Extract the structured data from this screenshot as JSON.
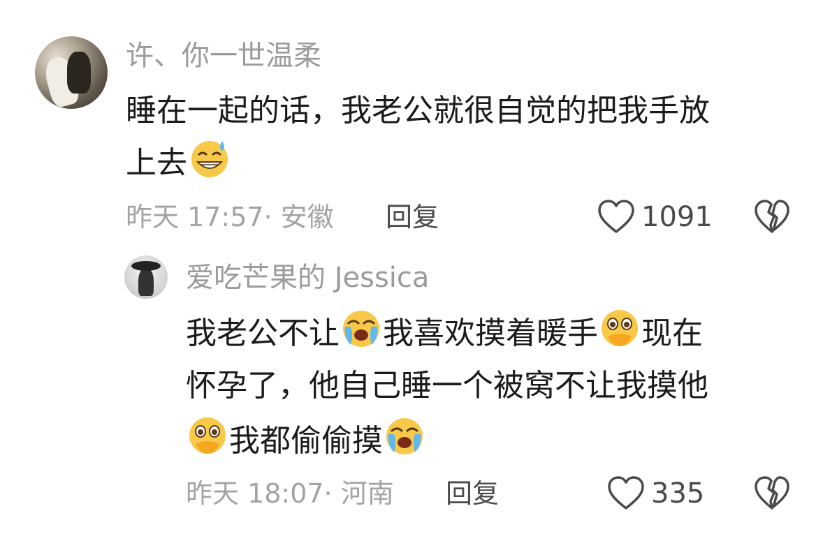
{
  "comment": {
    "username": "许、你一世温柔",
    "text_line1": "睡在一起的话，我老公就很自觉的把我手放",
    "text_line2": "上去",
    "emoji_end": "sweat-smile",
    "time_location": "昨天 17:57· 安徽",
    "reply_label": "回复",
    "likes": "1091"
  },
  "reply": {
    "username": "爱吃芒果的 Jessica",
    "line1_part1": "我老公不让",
    "line1_part2": "我喜欢摸着暖手",
    "line1_part3": "现在",
    "line2": "怀孕了，他自己睡一个被窝不让我摸他",
    "line3_part1": "我都偷偷摸",
    "emojis": [
      "loudly-crying-face",
      "face-holding-back-tears",
      "face-holding-back-tears",
      "loudly-crying-face"
    ],
    "time_location": "昨天 18:07· 河南",
    "reply_label": "回复",
    "likes": "335"
  },
  "icons": {
    "like": "heart-outline-icon",
    "dislike": "broken-heart-outline-icon"
  }
}
